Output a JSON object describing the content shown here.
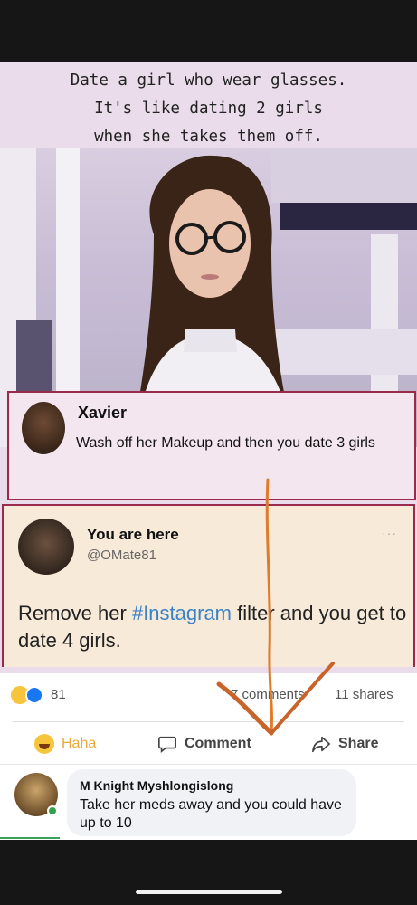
{
  "meme": {
    "caption": "Date a girl who wear glasses.\nIt's like dating 2 girls\nwhen she takes them off."
  },
  "xavier_comment": {
    "name": "Xavier",
    "text": "Wash off her Makeup and then you date 3 girls"
  },
  "tweet": {
    "name": "You are here",
    "handle": "@OMate81",
    "more": "···",
    "text_before": "Remove her ",
    "hashtag": "#Instagram",
    "text_after": " filter and you get to date 4 girls."
  },
  "reactions": {
    "count": "81",
    "comments": "7 comments",
    "shares": "11 shares"
  },
  "actions": {
    "haha": "Haha",
    "comment": "Comment",
    "share": "Share"
  },
  "comment": {
    "author": "M Knight Myshlongislong",
    "text": "Take her meds away and you could have up to 10"
  },
  "colors": {
    "box_border": "#9a2a4c",
    "hashtag": "#3b82c4",
    "annotation_arrow": "#e07b2a",
    "haha_label": "#e9a93a"
  },
  "icons": {
    "haha": "haha-reaction-icon",
    "like": "like-reaction-icon",
    "comment": "comment-bubble-icon",
    "share": "share-arrow-icon"
  }
}
